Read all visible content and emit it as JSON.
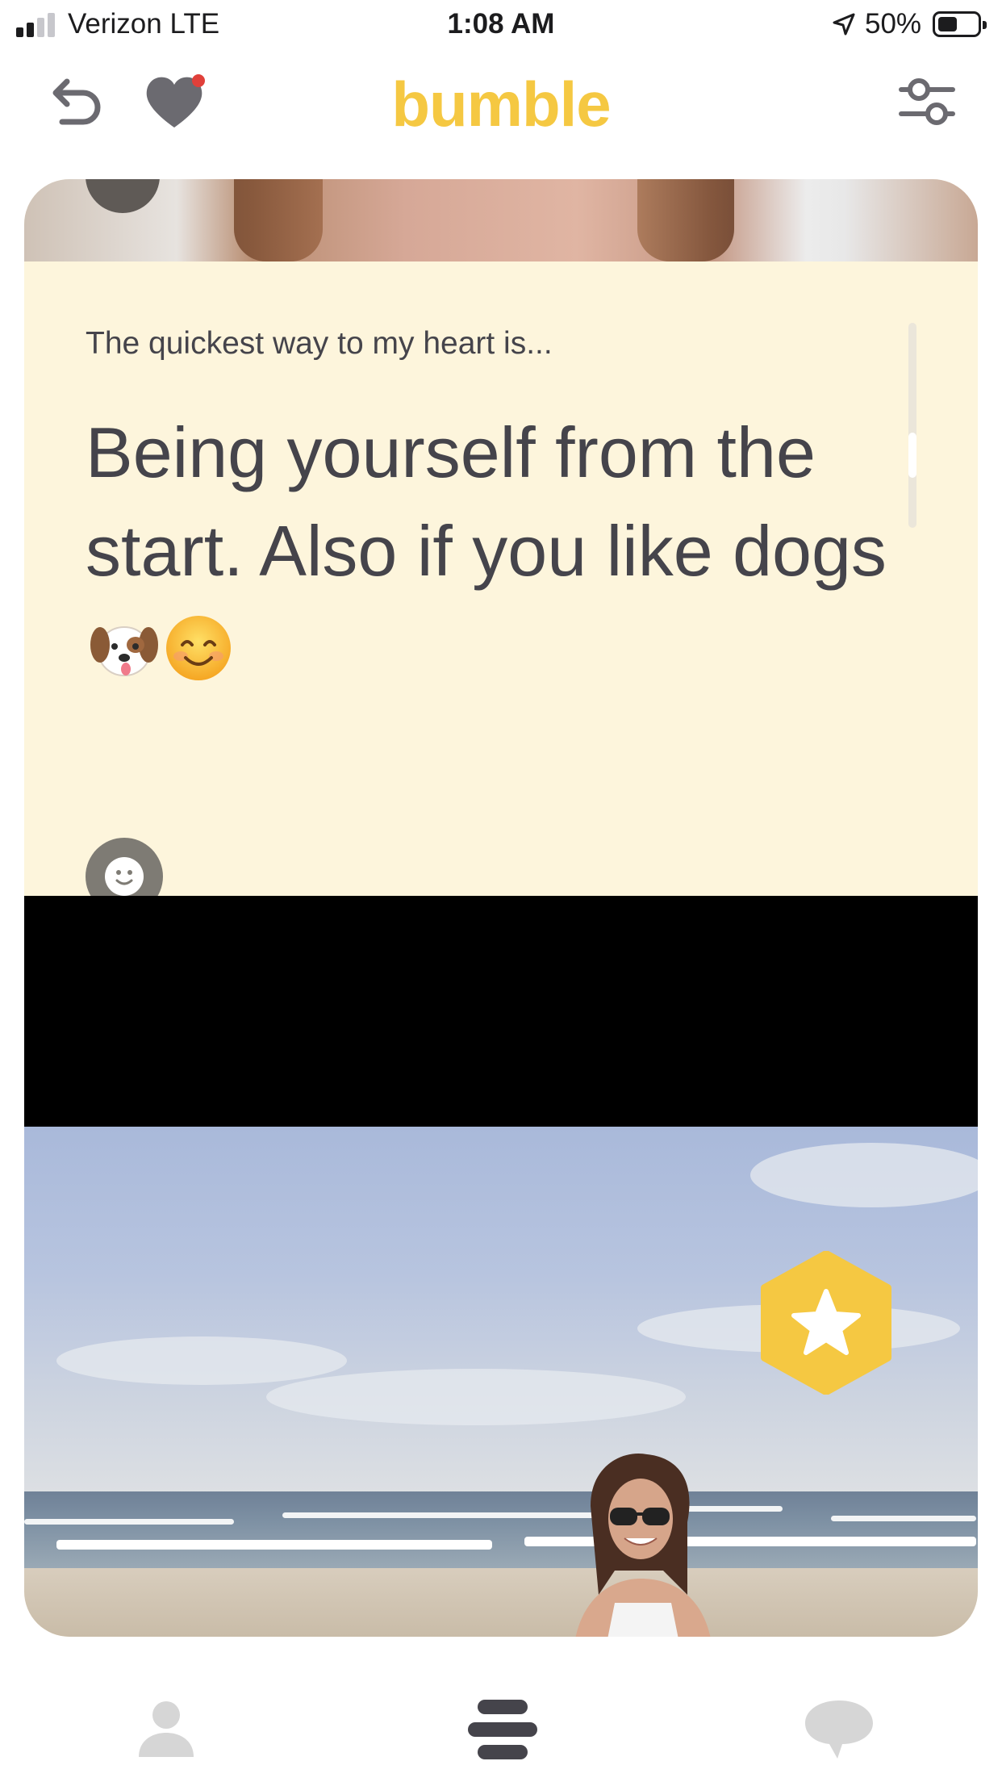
{
  "status_bar": {
    "carrier": "Verizon  LTE",
    "time": "1:08 AM",
    "battery_percent": "50%",
    "battery_level": 0.5,
    "signal_bars": 2,
    "location_icon": "location-arrow-icon"
  },
  "header": {
    "brand": "bumble",
    "back_icon": "undo-icon",
    "likes_icon": "heart-notification-icon",
    "filter_icon": "filter-sliders-icon",
    "notification_dot": true
  },
  "card": {
    "prompt_question": "The quickest way to my heart is...",
    "prompt_answer": "Being yourself from the start. Also if you like dogs",
    "answer_emojis": [
      "dog-face-emoji",
      "smiling-face-emoji"
    ],
    "react_icon": "smiley-icon",
    "superswipe_icon": "star-icon"
  },
  "bottom_nav": {
    "items": [
      {
        "name": "profile",
        "icon": "person-icon"
      },
      {
        "name": "discover",
        "icon": "stack-icon",
        "active": true
      },
      {
        "name": "chats",
        "icon": "chat-bubble-icon"
      }
    ]
  },
  "colors": {
    "brand_yellow": "#f5c842",
    "card_cream": "#fdf5dc",
    "text_dark": "#45444b",
    "icon_gray": "#6b6a70",
    "inactive_gray": "#d6d6d6",
    "notification_red": "#e0403a"
  }
}
